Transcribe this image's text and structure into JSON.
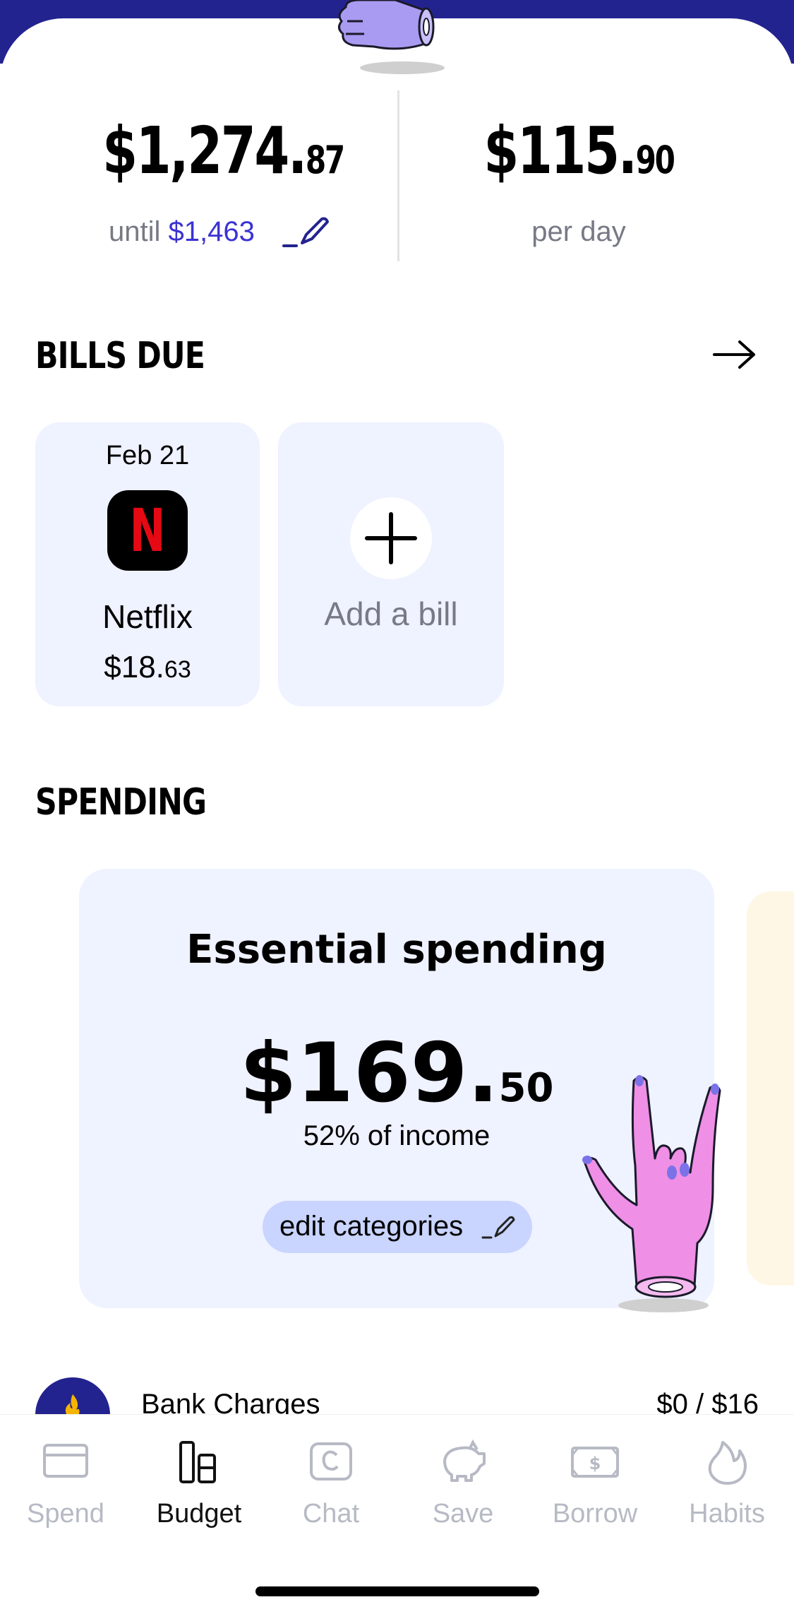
{
  "summary": {
    "remaining": {
      "main": "$1,274.",
      "cents": "87"
    },
    "until_label": "until",
    "until_amount": "$1,463",
    "per_day": {
      "main": "$115.",
      "cents": "90"
    },
    "per_day_label": "per day"
  },
  "bills": {
    "title": "BILLS DUE",
    "items": [
      {
        "date": "Feb 21",
        "name": "Netflix",
        "amount_main": "$18.",
        "amount_cents": "63",
        "logo_letter": "N"
      }
    ],
    "add_label": "Add a bill"
  },
  "spending": {
    "title": "SPENDING",
    "card_title": "Essential spending",
    "amount_main": "$169.",
    "amount_cents": "50",
    "percent_label": "52% of income",
    "edit_label": "edit categories"
  },
  "categories": [
    {
      "name": "Bank Charges",
      "value": "$0 / $16"
    }
  ],
  "nav": {
    "tabs": [
      {
        "label": "Spend",
        "icon": "card-icon",
        "active": false
      },
      {
        "label": "Budget",
        "icon": "budget-icon",
        "active": true
      },
      {
        "label": "Chat",
        "icon": "chat-icon",
        "active": false
      },
      {
        "label": "Save",
        "icon": "piggy-bank-icon",
        "active": false
      },
      {
        "label": "Borrow",
        "icon": "cash-icon",
        "active": false
      },
      {
        "label": "Habits",
        "icon": "flame-icon",
        "active": false
      }
    ]
  },
  "colors": {
    "brand_dark": "#23238f",
    "accent_link": "#3b32d4",
    "card_bg": "#eff2ff",
    "chip_bg": "#c9d4ff",
    "netflix_red": "#e50914",
    "inactive_tab": "#b7bac4"
  }
}
